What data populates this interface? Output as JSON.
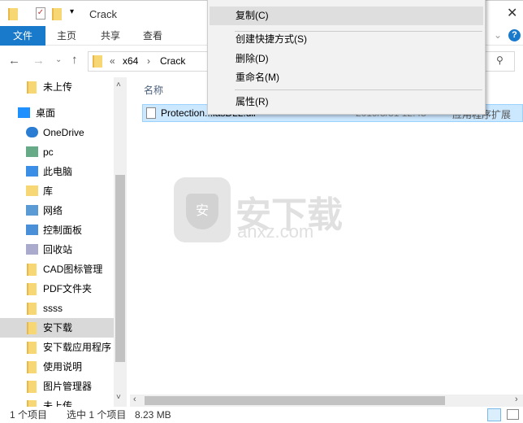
{
  "title": "Crack",
  "ribbon": {
    "tabs": [
      "文件",
      "主页",
      "共享",
      "查看"
    ]
  },
  "address": {
    "path": [
      "«",
      "x64",
      "›",
      "Crack"
    ]
  },
  "content": {
    "column_name": "名称",
    "file": {
      "name": "Protection...lasDLL.dll",
      "date": "2019/3/31 12:48",
      "type": "应用程序扩展"
    }
  },
  "nav": [
    "未上传",
    "桌面",
    "OneDrive",
    "pc",
    "此电脑",
    "库",
    "网络",
    "控制面板",
    "回收站",
    "CAD图标管理",
    "PDF文件夹",
    "ssss",
    "安下载",
    "安下载应用程序",
    "使用说明",
    "图片管理器",
    "未上传"
  ],
  "menu": {
    "items": [
      "复制(C)",
      "创建快捷方式(S)",
      "删除(D)",
      "重命名(M)",
      "属性(R)"
    ]
  },
  "watermark": {
    "text": "安下载",
    "sub": "anxz.com"
  },
  "status": {
    "count": "1 个项目",
    "selected": "选中 1 个项目",
    "size": "8.23 MB"
  },
  "colors": {
    "accent": "#1979ca",
    "selection": "#cce8ff"
  }
}
